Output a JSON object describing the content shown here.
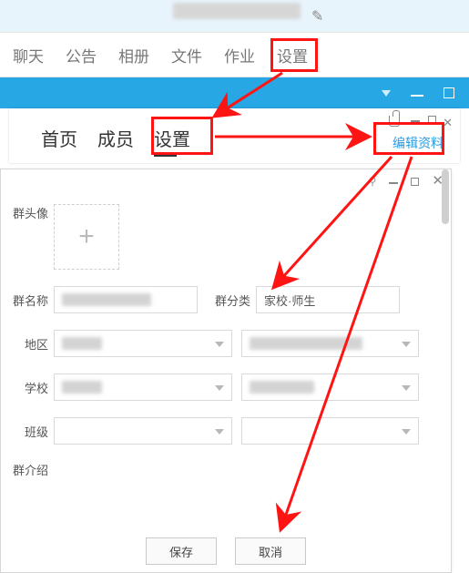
{
  "tabs_primary": [
    "聊天",
    "公告",
    "相册",
    "文件",
    "作业",
    "设置"
  ],
  "tabs_secondary": [
    "首页",
    "成员",
    "设置"
  ],
  "edit_profile": "编辑资料",
  "form": {
    "avatar_label": "群头像",
    "name_label": "群名称",
    "category_label": "群分类",
    "category_value": "家校·师生",
    "region_label": "地区",
    "school_label": "学校",
    "class_label": "班级",
    "intro_label": "群介绍",
    "save": "保存",
    "cancel": "取消"
  }
}
